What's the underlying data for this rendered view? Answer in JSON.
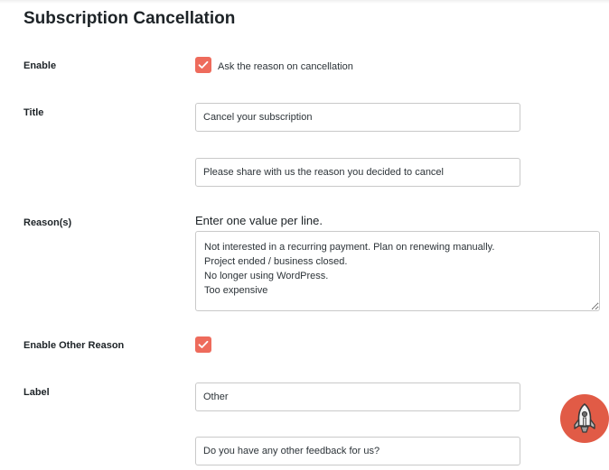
{
  "page": {
    "title": "Subscription Cancellation"
  },
  "colors": {
    "accent": "#ee6b5c",
    "launcher": "#e15b46",
    "input_border": "#c9c9c9"
  },
  "settings": {
    "enable": {
      "label": "Enable",
      "checked": true,
      "checkbox_label": "Ask the reason on cancellation"
    },
    "title": {
      "label": "Title",
      "value": "Cancel your subscription",
      "description_value": "Please share with us the reason you decided to cancel"
    },
    "reasons": {
      "label": "Reason(s)",
      "hint": "Enter one value per line.",
      "value": "Not interested in a recurring payment. Plan on renewing manually.\nProject ended / business closed.\nNo longer using WordPress.\nToo expensive"
    },
    "enable_other": {
      "label": "Enable Other Reason",
      "checked": true
    },
    "other_label": {
      "label": "Label",
      "value": "Other",
      "feedback_value": "Do you have any other feedback for us?"
    }
  },
  "launcher": {
    "icon": "rocket-icon"
  }
}
